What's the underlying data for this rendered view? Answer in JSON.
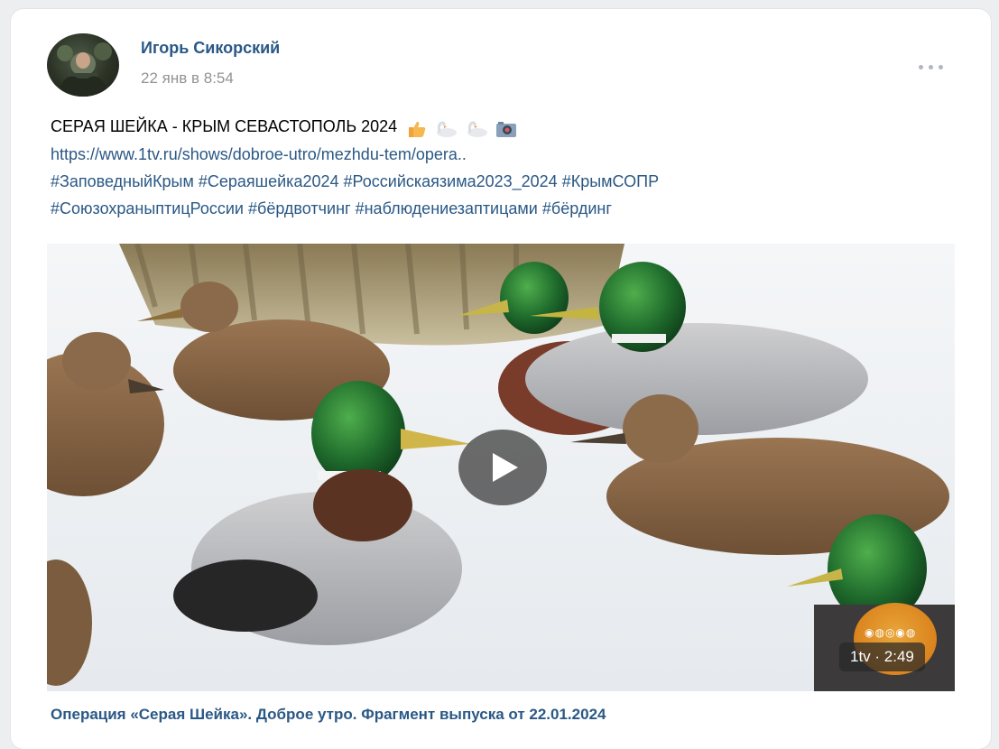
{
  "post": {
    "author": "Игорь Сикорский",
    "date": "22 янв в 8:54",
    "title": "СЕРАЯ ШЕЙКА - КРЫМ СЕВАСТОПОЛЬ 2024",
    "emojis": [
      "thumbs-up-icon",
      "swan-icon",
      "swan-icon",
      "camera-icon"
    ],
    "link": "https://www.1tv.ru/shows/dobroe-utro/mezhdu-tem/opera..",
    "hashtags_line1": [
      "#ЗаповедныйКрым",
      "#Сераяшейка2024",
      "#Российскаязима2023_2024",
      "#КрымСОПР"
    ],
    "hashtags_line2": [
      "#СоюзохраныптицРоссии",
      "#бёрдвотчинг",
      "#наблюдениезаптицами",
      "#бёрдинг"
    ]
  },
  "video": {
    "badge": "1tv · 2:49",
    "caption": "Операция «Серая Шейка». Доброе утро. Фрагмент выпуска от 22.01.2024"
  },
  "colors": {
    "link": "#2a5885",
    "meta": "#939393",
    "background": "#edeef0"
  }
}
